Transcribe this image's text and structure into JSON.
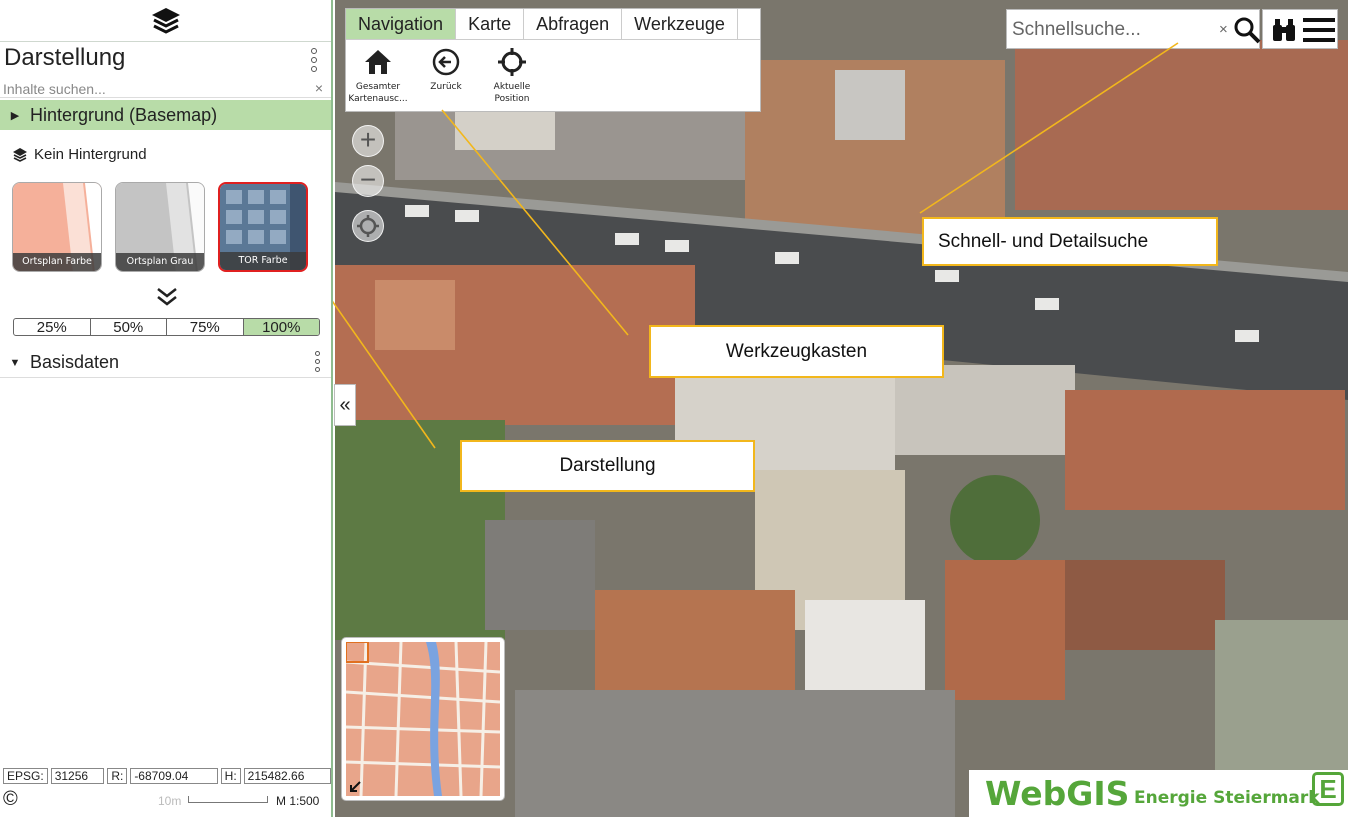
{
  "panel": {
    "title": "Darstellung",
    "search_placeholder": "Inhalte suchen...",
    "search_clear": "×",
    "group_background": "Hintergrund (Basemap)",
    "no_background": "Kein Hintergrund",
    "basemaps": [
      {
        "label": "Ortsplan Farbe",
        "selected": false
      },
      {
        "label": "Ortsplan Grau",
        "selected": false
      },
      {
        "label": "TOR Farbe",
        "selected": true
      }
    ],
    "opacity_options": [
      "25%",
      "50%",
      "75%",
      "100%"
    ],
    "opacity_selected": "100%",
    "group_base": "Basisdaten",
    "collapse_label": "«"
  },
  "coords": {
    "epsg_label": "EPSG:",
    "epsg": "31256",
    "r_label": "R:",
    "r": "-68709.04",
    "h_label": "H:",
    "h": "215482.66"
  },
  "scale": {
    "copyright": "©",
    "distance": "10m",
    "ratio": "M 1:500"
  },
  "toolbox": {
    "tabs": [
      "Navigation",
      "Karte",
      "Abfragen",
      "Werkzeuge"
    ],
    "active_tab": "Navigation",
    "tools": [
      {
        "label_line1": "Gesamter",
        "label_line2": "Kartenausc...",
        "icon": "home-icon"
      },
      {
        "label_line1": "Zurück",
        "label_line2": "",
        "icon": "back-arrow-icon"
      },
      {
        "label_line1": "Aktuelle",
        "label_line2": "Position",
        "icon": "crosshair-icon"
      }
    ]
  },
  "map_controls": {
    "zoom_in": "+",
    "zoom_out": "−"
  },
  "quick_search": {
    "placeholder": "Schnellsuche...",
    "clear": "×"
  },
  "callouts": {
    "search": "Schnell- und Detailsuche",
    "toolbox": "Werkzeugkasten",
    "display": "Darstellung"
  },
  "brand": {
    "name": "WebGIS",
    "company": "Energie Steiermark",
    "logo_letter": "E"
  },
  "colors": {
    "accent_green": "#b8dca8",
    "brand_green": "#55a63a",
    "callout_border": "#f2b71c",
    "selected_red": "#e02020"
  }
}
